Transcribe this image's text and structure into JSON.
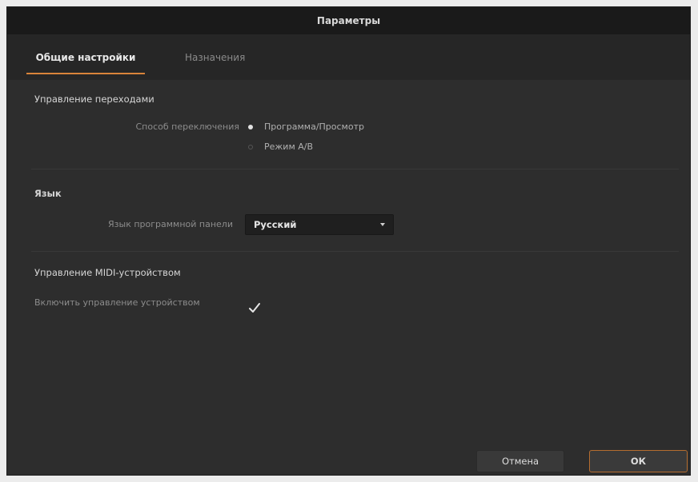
{
  "window": {
    "title": "Параметры"
  },
  "tabs": [
    {
      "label": "Общие настройки",
      "active": true
    },
    {
      "label": "Назначения",
      "active": false
    }
  ],
  "transition_control": {
    "title": "Управление переходами",
    "switch_label": "Способ переключения",
    "options": [
      {
        "label": "Программа/Просмотр",
        "selected": true
      },
      {
        "label": "Режим A/B",
        "selected": false
      }
    ]
  },
  "language": {
    "title": "Язык",
    "label": "Язык программной панели",
    "selected": "Русский"
  },
  "midi": {
    "title": "Управление MIDI-устройством",
    "enable_label": "Включить управление устройством",
    "enabled": true
  },
  "buttons": {
    "cancel": "Отмена",
    "ok": "ОК"
  },
  "colors": {
    "accent": "#d9843a",
    "background": "#2d2d2d",
    "titlebar": "#1a1a1a"
  }
}
